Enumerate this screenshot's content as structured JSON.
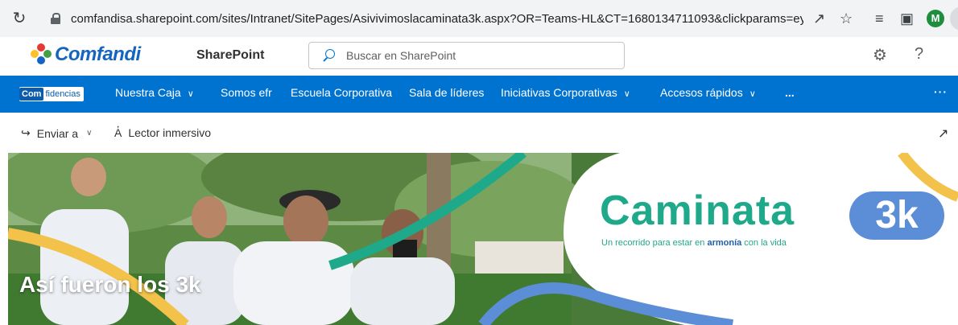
{
  "browser": {
    "url": "comfandisa.sharepoint.com/sites/Intranet/SitePages/Asivivimoslacaminata3k.aspx?OR=Teams-HL&CT=1680134711093&clickparams=eyJB...",
    "profile_initial": "M"
  },
  "header": {
    "logo_text": "Comfandi",
    "app_title": "SharePoint",
    "search_placeholder": "Buscar en SharePoint"
  },
  "nav": {
    "brand_part1": "Com",
    "brand_part2": "fidencias",
    "items": [
      {
        "label": "Nuestra Caja",
        "has_dropdown": true
      },
      {
        "label": "Somos efr",
        "has_dropdown": false
      },
      {
        "label": "Escuela Corporativa",
        "has_dropdown": false
      },
      {
        "label": "Sala de líderes",
        "has_dropdown": false
      },
      {
        "label": "Iniciativas Corporativas",
        "has_dropdown": true
      },
      {
        "label": "Accesos rápidos",
        "has_dropdown": true
      }
    ],
    "more_label": "...",
    "overflow_label": "···"
  },
  "commands": {
    "send_to": "Enviar a",
    "immersive_reader": "Lector inmersivo"
  },
  "hero": {
    "title": "Así fueron los 3k",
    "banner_title": "Caminata",
    "banner_badge": "3k",
    "tagline_pre": "Un recorrido para estar en ",
    "tagline_bold": "armonía",
    "tagline_post": " con la vida"
  },
  "colors": {
    "nav_bg": "#0073d1",
    "brand_blue": "#1565c0",
    "banner_teal": "#1ea98a",
    "badge_blue": "#5b8ed6"
  }
}
